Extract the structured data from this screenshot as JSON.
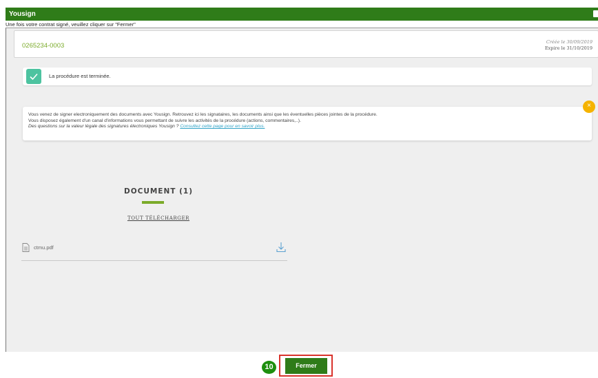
{
  "window": {
    "title": "Yousign"
  },
  "instruction": "Une fois votre contrat signé, veuillez cliquer sur \"Fermer\"",
  "procedure": {
    "reference": "0265234-0003",
    "created": "Créée le 30/09/2019",
    "expires": "Expire le 31/10/2019"
  },
  "status": {
    "icon": "check-icon",
    "text": "La procédure est terminée."
  },
  "info": {
    "line1": "Vous venez de signer electroniquement des documents avec Yousign. Retrouvez ici les signataires, les documents ainsi que les éventuelles pièces jointes de la procédure.",
    "line2": "Vous disposez également d'un canal d'informations vous permettant de suivre les activités de la procédure (actions, commentaires,..).",
    "question": "Des questions sur la valeur légale des signatures électroniques Yousign ?",
    "link": "Consultez cette page pour en savoir plus.",
    "close_symbol": "×"
  },
  "documents": {
    "heading": "DOCUMENT (1)",
    "download_all": "TOUT TÉLÉCHARGER",
    "files": [
      {
        "name": "ctmu.pdf",
        "icon": "file-icon",
        "action_icon": "download-icon"
      }
    ]
  },
  "footer": {
    "step_badge": "10",
    "close_button": "Fermer"
  },
  "colors": {
    "brand_green": "#2f7c19",
    "accent_green": "#7bab2a",
    "success": "#4dc3a0",
    "warning": "#f5b300",
    "highlight": "#d9322b"
  }
}
